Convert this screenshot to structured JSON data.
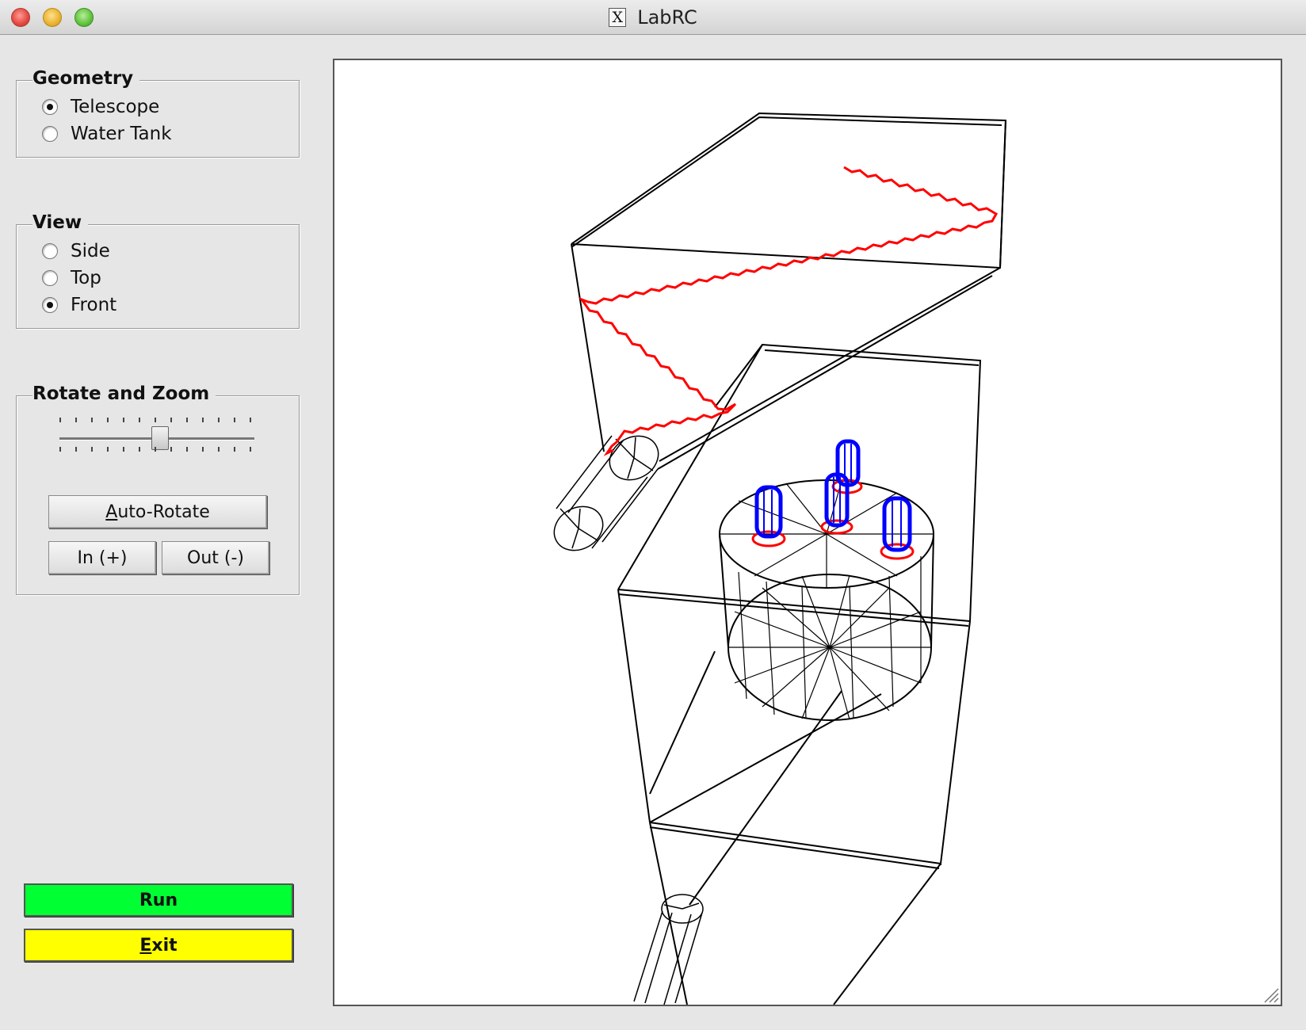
{
  "window": {
    "title": "LabRC",
    "title_icon": "x11-icon"
  },
  "geometry": {
    "legend": "Geometry",
    "options": [
      {
        "label": "Telescope",
        "checked": true
      },
      {
        "label": "Water Tank",
        "checked": false
      }
    ]
  },
  "view": {
    "legend": "View",
    "options": [
      {
        "label": "Side",
        "checked": false
      },
      {
        "label": "Top",
        "checked": false
      },
      {
        "label": "Front",
        "checked": true
      }
    ]
  },
  "rotate_zoom": {
    "legend": "Rotate and Zoom",
    "slider_value": 0.5,
    "auto_rotate_rest": "uto-Rotate",
    "auto_rotate_mnemonic": "A",
    "zoom_in_label": "In (+)",
    "zoom_out_label": "Out (-)"
  },
  "actions": {
    "run_label": "Run",
    "run_color": "#00ff33",
    "exit_mnemonic": "E",
    "exit_rest": "xit",
    "exit_color": "#ffff00"
  },
  "scene": {
    "wire_color": "#000000",
    "track_color": "#ff0000",
    "pmt_color": "#0000ff"
  }
}
